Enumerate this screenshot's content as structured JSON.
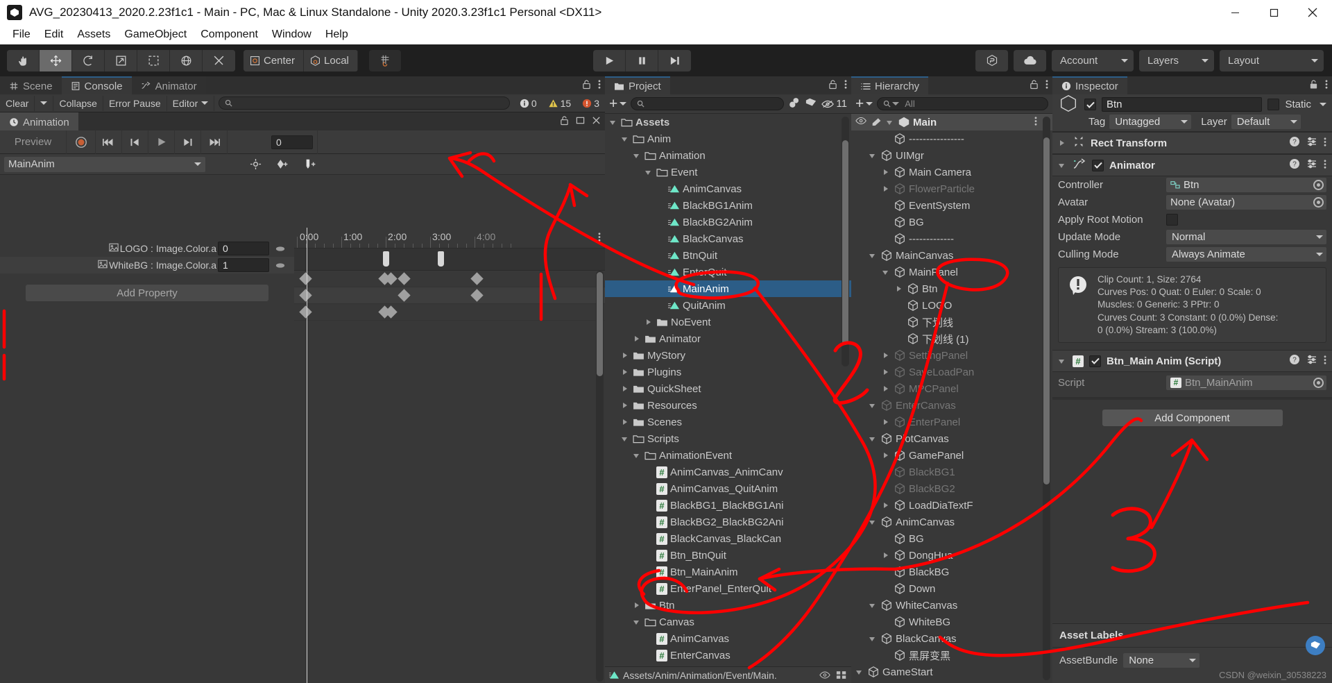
{
  "window": {
    "title": "AVG_20230413_2020.2.23f1c1 - Main - PC, Mac & Linux Standalone - Unity 2020.3.23f1c1 Personal <DX11>",
    "app_icon": "unity-icon",
    "minimize": "—",
    "maximize": "❐",
    "close": "✕"
  },
  "menubar": {
    "items": [
      "File",
      "Edit",
      "Assets",
      "GameObject",
      "Component",
      "Window",
      "Help"
    ]
  },
  "toolbar": {
    "tools": [
      {
        "name": "hand-tool",
        "glyph": "✋"
      },
      {
        "name": "move-tool",
        "glyph": "✚"
      },
      {
        "name": "rotate-tool",
        "glyph": "↻"
      },
      {
        "name": "scale-tool",
        "glyph": "↗"
      },
      {
        "name": "rect-tool",
        "glyph": "⬚"
      },
      {
        "name": "transform-tool",
        "glyph": "⊕"
      },
      {
        "name": "custom-tool",
        "glyph": "⚒"
      }
    ],
    "pivot_label": "Center",
    "handle_label": "Local",
    "grid_label": "grid-snapping",
    "play": "▶",
    "pause": "▐▐",
    "step": "▶|",
    "collab_label": "collab-icon",
    "cloud_label": "cloud-icon",
    "account_label": "Account",
    "layers_label": "Layers",
    "layout_label": "Layout"
  },
  "animation_panel": {
    "tabs": [
      {
        "label": "Scene",
        "icon": "grid-icon",
        "selected": false
      },
      {
        "label": "Console",
        "icon": "console-icon",
        "selected": true
      },
      {
        "label": "Animator",
        "icon": "animator-icon",
        "selected": false
      }
    ],
    "console_toolbar": {
      "clear": "Clear",
      "collapse": "Collapse",
      "error_pause": "Error Pause",
      "editor": "Editor",
      "search_placeholder": "",
      "info_count": "0",
      "warn_count": "15",
      "error_count": "3"
    },
    "anim_tab": {
      "label": "Animation",
      "icon": "clock-icon"
    },
    "controls": {
      "preview": "Preview",
      "record": "record-button",
      "first_key": "⏮",
      "prev_key": "⏴|",
      "play": "▶",
      "next_key": "|⏵",
      "last_key": "⏭",
      "frame": "0"
    },
    "clip_name": "MainAnim",
    "add_property": "Add Property",
    "properties": [
      {
        "name": "LOGO : Image.Color.a",
        "value": "0"
      },
      {
        "name": "WhiteBG : Image.Color.a",
        "value": "1"
      }
    ],
    "ruler_labels": [
      "0:00",
      "1:00",
      "2:00",
      "3:00",
      "4:00"
    ]
  },
  "project_panel": {
    "tab": {
      "label": "Project",
      "icon": "folder-icon"
    },
    "toolbar": {
      "create": "+",
      "search_placeholder": "",
      "hidden_count": "11"
    },
    "status": "Assets/Anim/Animation/Event/Main.",
    "tree": [
      {
        "label": "Assets",
        "depth": 0,
        "type": "folder",
        "state": "down",
        "bold": true
      },
      {
        "label": "Anim",
        "depth": 1,
        "type": "folder",
        "state": "down"
      },
      {
        "label": "Animation",
        "depth": 2,
        "type": "folder",
        "state": "down"
      },
      {
        "label": "Event",
        "depth": 3,
        "type": "folder",
        "state": "down"
      },
      {
        "label": "AnimCanvas",
        "depth": 4,
        "type": "anim"
      },
      {
        "label": "BlackBG1Anim",
        "depth": 4,
        "type": "anim"
      },
      {
        "label": "BlackBG2Anim",
        "depth": 4,
        "type": "anim"
      },
      {
        "label": "BlackCanvas",
        "depth": 4,
        "type": "anim"
      },
      {
        "label": "BtnQuit",
        "depth": 4,
        "type": "anim"
      },
      {
        "label": "EnterQuit",
        "depth": 4,
        "type": "anim"
      },
      {
        "label": "MainAnim",
        "depth": 4,
        "type": "anim",
        "selected": true
      },
      {
        "label": "QuitAnim",
        "depth": 4,
        "type": "anim"
      },
      {
        "label": "NoEvent",
        "depth": 3,
        "type": "folder",
        "state": "right"
      },
      {
        "label": "Animator",
        "depth": 2,
        "type": "folder",
        "state": "right"
      },
      {
        "label": "MyStory",
        "depth": 1,
        "type": "folder",
        "state": "right"
      },
      {
        "label": "Plugins",
        "depth": 1,
        "type": "folder",
        "state": "right"
      },
      {
        "label": "QuickSheet",
        "depth": 1,
        "type": "folder",
        "state": "right"
      },
      {
        "label": "Resources",
        "depth": 1,
        "type": "folder",
        "state": "right"
      },
      {
        "label": "Scenes",
        "depth": 1,
        "type": "folder",
        "state": "right"
      },
      {
        "label": "Scripts",
        "depth": 1,
        "type": "folder",
        "state": "down"
      },
      {
        "label": "AnimationEvent",
        "depth": 2,
        "type": "folder",
        "state": "down"
      },
      {
        "label": "AnimCanvas_AnimCanv",
        "depth": 3,
        "type": "script"
      },
      {
        "label": "AnimCanvas_QuitAnim",
        "depth": 3,
        "type": "script"
      },
      {
        "label": "BlackBG1_BlackBG1Ani",
        "depth": 3,
        "type": "script"
      },
      {
        "label": "BlackBG2_BlackBG2Ani",
        "depth": 3,
        "type": "script"
      },
      {
        "label": "BlackCanvas_BlackCan",
        "depth": 3,
        "type": "script"
      },
      {
        "label": "Btn_BtnQuit",
        "depth": 3,
        "type": "script"
      },
      {
        "label": "Btn_MainAnim",
        "depth": 3,
        "type": "script"
      },
      {
        "label": "EnterPanel_EnterQuit",
        "depth": 3,
        "type": "script"
      },
      {
        "label": "Btn",
        "depth": 2,
        "type": "folder",
        "state": "right"
      },
      {
        "label": "Canvas",
        "depth": 2,
        "type": "folder",
        "state": "down"
      },
      {
        "label": "AnimCanvas",
        "depth": 3,
        "type": "script"
      },
      {
        "label": "EnterCanvas",
        "depth": 3,
        "type": "script"
      }
    ]
  },
  "hierarchy_panel": {
    "tab": {
      "label": "Hierarchy",
      "icon": "hierarchy-icon"
    },
    "toolbar": {
      "create": "+",
      "search_placeholder": "All"
    },
    "tree": [
      {
        "label": "Main",
        "depth": 0,
        "state": "down",
        "header": true
      },
      {
        "label": "----------------",
        "depth": 2,
        "state": "none"
      },
      {
        "label": "UIMgr",
        "depth": 1,
        "state": "down"
      },
      {
        "label": "Main Camera",
        "depth": 2,
        "state": "right"
      },
      {
        "label": "FlowerParticle",
        "depth": 2,
        "state": "right",
        "dim": true
      },
      {
        "label": "EventSystem",
        "depth": 2,
        "state": "none"
      },
      {
        "label": "BG",
        "depth": 2,
        "state": "none"
      },
      {
        "label": "-------------",
        "depth": 2,
        "state": "none"
      },
      {
        "label": "MainCanvas",
        "depth": 1,
        "state": "down"
      },
      {
        "label": "MainPanel",
        "depth": 2,
        "state": "down"
      },
      {
        "label": "Btn",
        "depth": 3,
        "state": "right"
      },
      {
        "label": "LOGO",
        "depth": 3,
        "state": "none"
      },
      {
        "label": "下划线",
        "depth": 3,
        "state": "none"
      },
      {
        "label": "下划线 (1)",
        "depth": 3,
        "state": "none"
      },
      {
        "label": "SettingPanel",
        "depth": 2,
        "state": "right",
        "dim": true
      },
      {
        "label": "SaveLoadPan",
        "depth": 2,
        "state": "right",
        "dim": true
      },
      {
        "label": "MPCPanel",
        "depth": 2,
        "state": "right",
        "dim": true
      },
      {
        "label": "EnterCanvas",
        "depth": 1,
        "state": "down",
        "dim": true
      },
      {
        "label": "EnterPanel",
        "depth": 2,
        "state": "right",
        "dim": true
      },
      {
        "label": "PlotCanvas",
        "depth": 1,
        "state": "down"
      },
      {
        "label": "GamePanel",
        "depth": 2,
        "state": "right"
      },
      {
        "label": "BlackBG1",
        "depth": 2,
        "state": "none",
        "dim": true
      },
      {
        "label": "BlackBG2",
        "depth": 2,
        "state": "none",
        "dim": true
      },
      {
        "label": "LoadDiaTextF",
        "depth": 2,
        "state": "right"
      },
      {
        "label": "AnimCanvas",
        "depth": 1,
        "state": "down"
      },
      {
        "label": "BG",
        "depth": 2,
        "state": "none"
      },
      {
        "label": "DongHua",
        "depth": 2,
        "state": "right"
      },
      {
        "label": "BlackBG",
        "depth": 2,
        "state": "none"
      },
      {
        "label": "Down",
        "depth": 2,
        "state": "none"
      },
      {
        "label": "WhiteCanvas",
        "depth": 1,
        "state": "down"
      },
      {
        "label": "WhiteBG",
        "depth": 2,
        "state": "none"
      },
      {
        "label": "BlackCanvas",
        "depth": 1,
        "state": "down"
      },
      {
        "label": "黑屏变黑",
        "depth": 2,
        "state": "none"
      },
      {
        "label": "GameStart",
        "depth": 0,
        "state": "down"
      }
    ]
  },
  "inspector_panel": {
    "tab": {
      "label": "Inspector",
      "icon": "info-icon"
    },
    "object_name": "Btn",
    "static_label": "Static",
    "tag_label": "Tag",
    "tag_value": "Untagged",
    "layer_label": "Layer",
    "layer_value": "Default",
    "components": [
      {
        "title": "Rect Transform",
        "icon": "rect-transform-icon",
        "expanded": false
      },
      {
        "title": "Animator",
        "icon": "animator-icon",
        "expanded": true
      },
      {
        "title": "Btn_Main Anim (Script)",
        "icon": "script-icon",
        "expanded": true
      }
    ],
    "animator": {
      "controller_label": "Controller",
      "controller_value": "Btn",
      "avatar_label": "Avatar",
      "avatar_value": "None (Avatar)",
      "apply_root_motion_label": "Apply Root Motion",
      "update_mode_label": "Update Mode",
      "update_mode_value": "Normal",
      "culling_mode_label": "Culling Mode",
      "culling_mode_value": "Always Animate",
      "info_lines": [
        "Clip Count: 1, Size: 2764",
        "Curves Pos: 0 Quat: 0 Euler: 0 Scale: 0",
        "Muscles: 0 Generic: 3 PPtr: 0",
        "Curves Count: 3 Constant: 0 (0.0%) Dense:",
        "0 (0.0%) Stream: 3 (100.0%)"
      ]
    },
    "script_component": {
      "script_label": "Script",
      "script_value": "Btn_MainAnim"
    },
    "add_component": "Add Component",
    "asset_labels_title": "Asset Labels",
    "asset_bundle_label": "AssetBundle",
    "asset_bundle_value": "None"
  },
  "annotations": {
    "marker_2": "2",
    "marker_3": "3",
    "color": "#ff0000"
  },
  "watermark": "CSDN @weixin_30538223"
}
